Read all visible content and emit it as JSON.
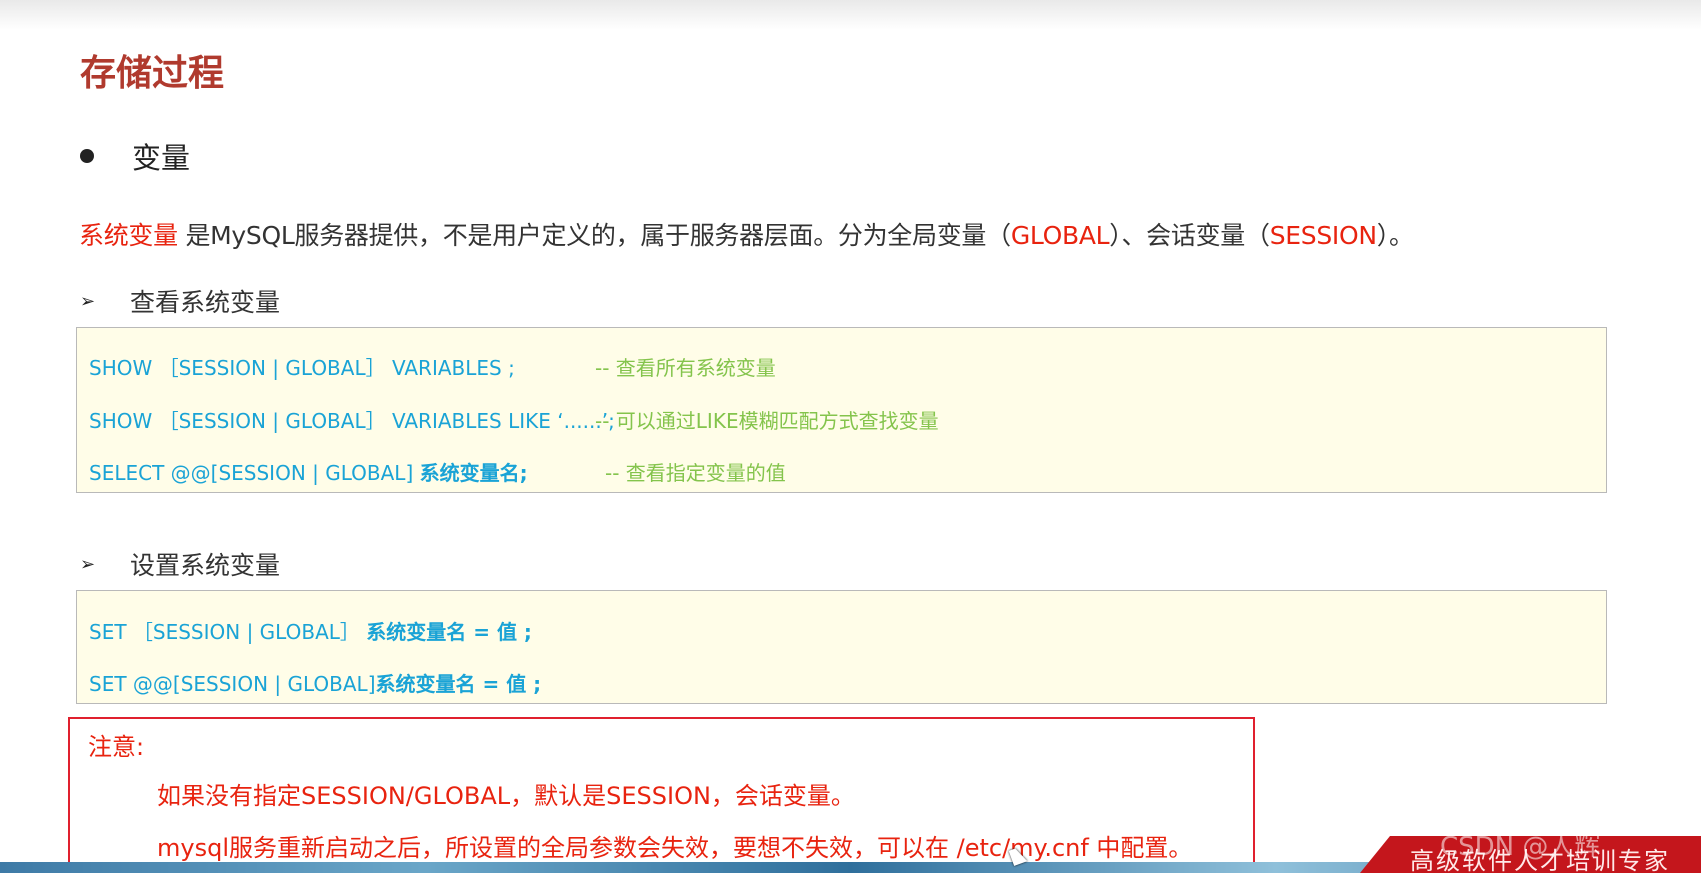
{
  "slide": {
    "title": "存储过程",
    "bullet": "变量",
    "intro": {
      "term": "系统变量",
      "text_a": " 是MySQL服务器提供，不是用户定义的，属于服务器层面。分为全局变量（",
      "global": "GLOBAL",
      "text_b": "）、会话变量（",
      "session": "SESSION",
      "text_c": "）。"
    }
  },
  "view_section": {
    "heading": "查看系统变量",
    "lines": [
      {
        "code": "SHOW ［SESSION | GLOBAL］ VARIABLES ;",
        "comment": "-- 查看所有系统变量"
      },
      {
        "code": "SHOW ［SESSION | GLOBAL］ VARIABLES LIKE ‘......’;",
        "comment": "-- 可以通过LIKE模糊匹配方式查找变量"
      },
      {
        "code": "SELECT @@[SESSION | GLOBAL] ",
        "code_strong": "系统变量名;",
        "comment": "-- 查看指定变量的值"
      }
    ]
  },
  "set_section": {
    "heading": "设置系统变量",
    "lines": [
      {
        "code": "SET ［SESSION | GLOBAL］ ",
        "code_strong": "系统变量名 = 值 ;"
      },
      {
        "code": "SET @@[SESSION | GLOBAL]",
        "code_strong": "系统变量名 = 值 ;"
      }
    ]
  },
  "note": {
    "title": "注意:",
    "lines": [
      "如果没有指定SESSION/GLOBAL，默认是SESSION，会话变量。",
      "mysql服务重新启动之后，所设置的全局参数会失效，要想不失效，可以在 /etc/my.cnf 中配置。"
    ]
  },
  "footer": {
    "brand": "高级软件人才培训专家",
    "watermark": "CSDN @人辉"
  },
  "colors": {
    "title": "#b03a2e",
    "highlight_red": "#e8230f",
    "code_blue": "#1aa3d6",
    "comment_green": "#84c44c",
    "code_bg": "#fffde8"
  }
}
